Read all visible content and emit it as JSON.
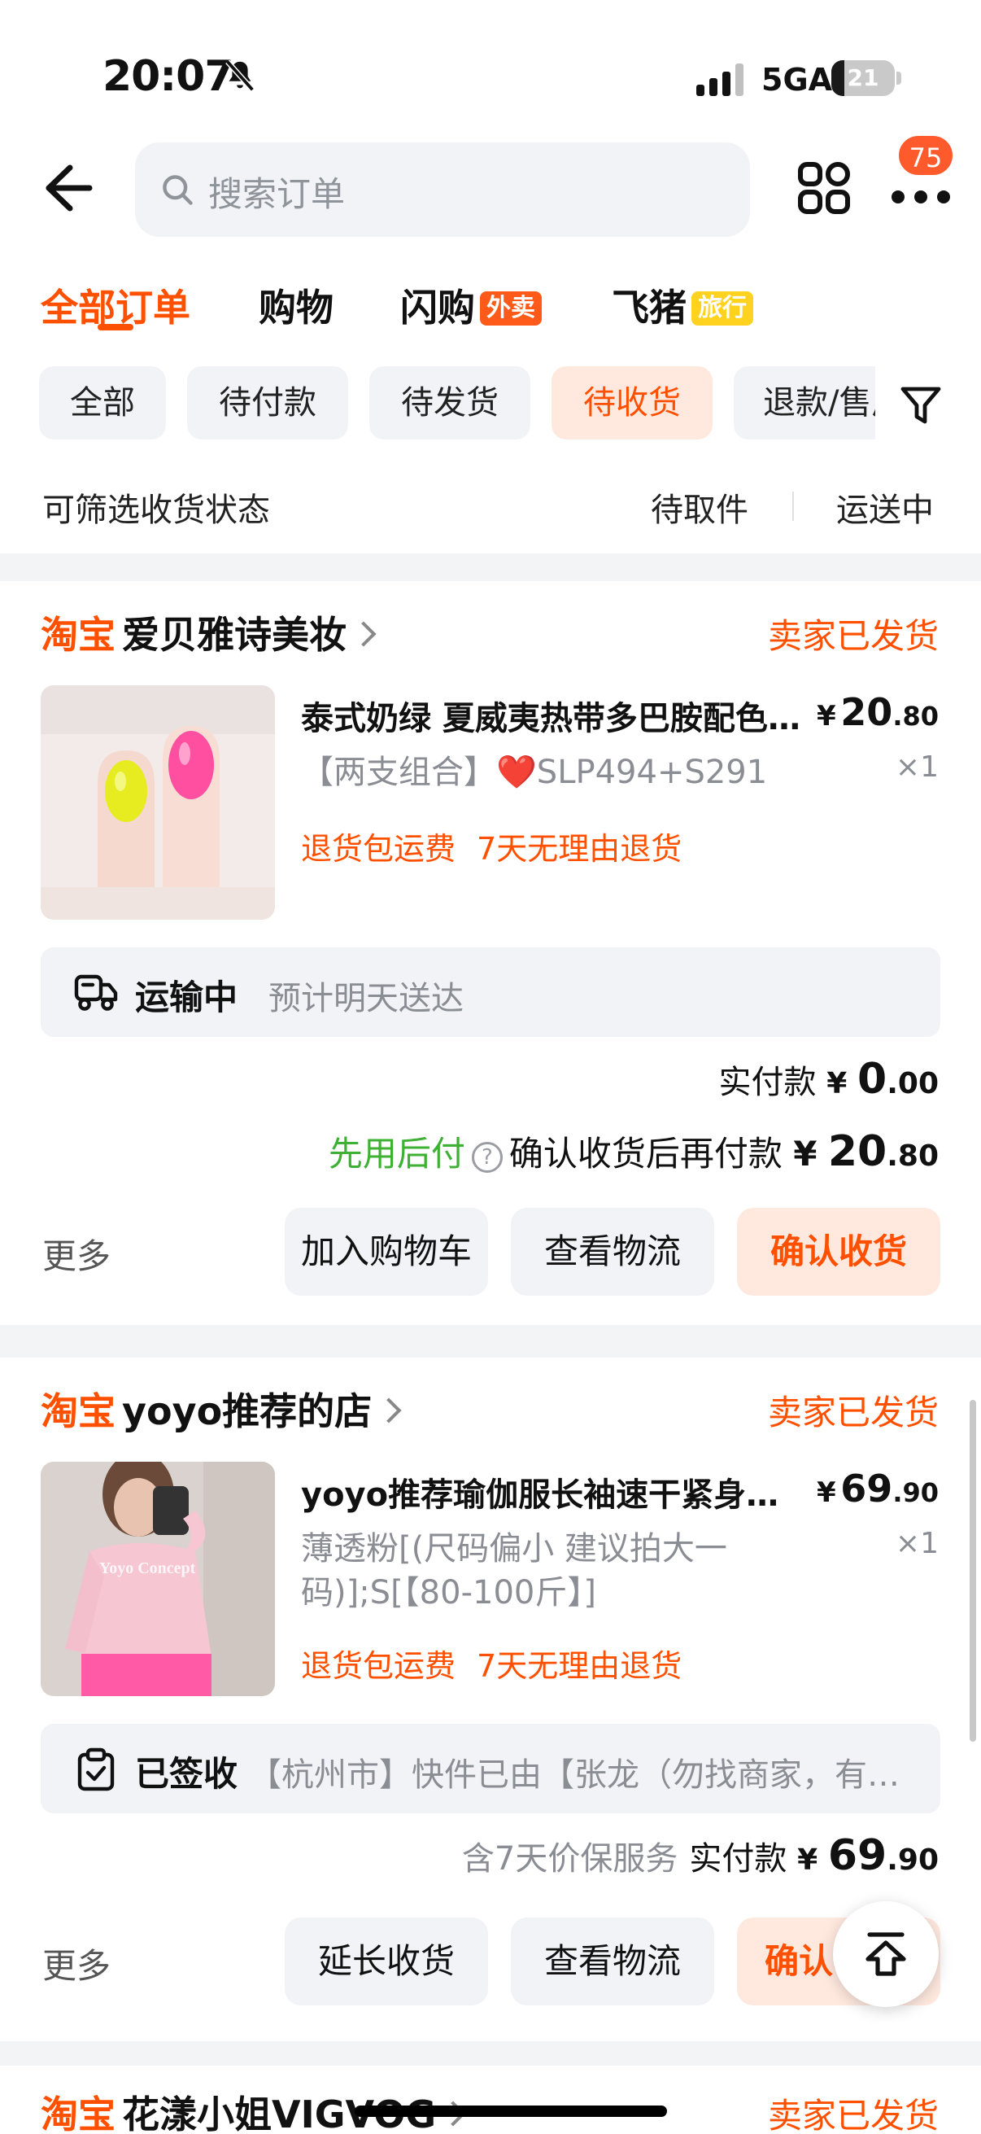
{
  "status_bar": {
    "time": "20:07",
    "network": "5GA",
    "battery": "21",
    "battery_level": 0.21
  },
  "search": {
    "placeholder": "搜索订单"
  },
  "header": {
    "notification_count": "75"
  },
  "main_tabs": [
    {
      "label": "全部订单"
    },
    {
      "label": "购物"
    },
    {
      "label": "闪购",
      "tag": "外卖"
    },
    {
      "label": "飞猪",
      "tag": "旅行"
    }
  ],
  "chips": [
    "全部",
    "待付款",
    "待发货",
    "待收货",
    "退款/售后"
  ],
  "subfilter": {
    "label": "可筛选收货状态",
    "options": [
      "待取件",
      "运送中"
    ]
  },
  "orders": [
    {
      "platform": "淘宝",
      "shop": "爱贝雅诗美妆",
      "status": "卖家已发货",
      "title": "泰式奶绿 夏威夷热带多巴胺配色美甲",
      "price_cur": "¥",
      "price_int": "20",
      "price_dec": ".80",
      "sku": "【两支组合】❤️SLP494+S291",
      "qty": "×1",
      "services": [
        "退货包运费",
        "7天无理由退货"
      ],
      "logistics_status": "运输中",
      "logistics_desc": "预计明天送达",
      "paid_label": "实付款",
      "paid_cur": "¥",
      "paid_int": "0",
      "paid_dec": ".00",
      "paylater_brand": "先用后付",
      "paylater_text": "确认收货后再付款",
      "paylater_cur": "¥",
      "paylater_int": "20",
      "paylater_dec": ".80",
      "more": "更多",
      "buttons": [
        "加入购物车",
        "查看物流",
        "确认收货"
      ]
    },
    {
      "platform": "淘宝",
      "shop": "yoyo推荐的店",
      "status": "卖家已发货",
      "title": "yoyo推荐瑜伽服长袖速干紧身上衣",
      "price_cur": "¥",
      "price_int": "69",
      "price_dec": ".90",
      "sku": "薄透粉[(尺码偏小 建议拍大一码)];S[【80-100斤】]",
      "qty": "×1",
      "image_text": "Yoyo Concept",
      "services": [
        "退货包运费",
        "7天无理由退货"
      ],
      "logistics_status": "已签收",
      "logistics_desc": "【杭州市】快件已由【张龙（勿找商家，有问题联系快递员）】签收",
      "guarantee": "含7天价保服务",
      "paid_label": "实付款",
      "paid_cur": "¥",
      "paid_int": "69",
      "paid_dec": ".90",
      "more": "更多",
      "buttons": [
        "延长收货",
        "查看物流",
        "确认收货"
      ]
    },
    {
      "platform": "淘宝",
      "shop": "花漾小姐VIGVOG",
      "status": "卖家已发货"
    }
  ],
  "colors": {
    "accent": "#ff5000",
    "green": "#3eb034",
    "background": "#f3f4f6"
  }
}
